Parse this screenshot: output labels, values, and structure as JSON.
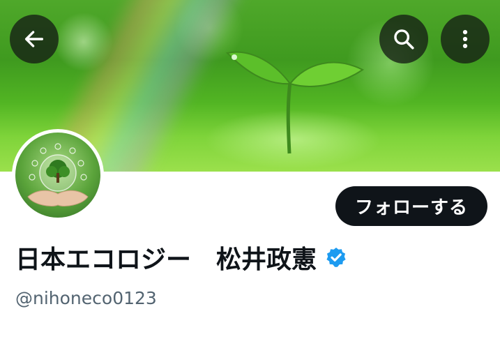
{
  "header": {
    "back_icon": "arrow-left-icon",
    "search_icon": "search-icon",
    "more_icon": "more-vertical-icon"
  },
  "profile": {
    "follow_label": "フォローする",
    "display_name": "日本エコロジー　松井政憲",
    "verified_icon": "verified-badge-icon",
    "handle": "@nihoneco0123"
  },
  "colors": {
    "follow_bg": "#0f1419",
    "verified_blue": "#1d9bf0",
    "handle_gray": "#536471"
  }
}
